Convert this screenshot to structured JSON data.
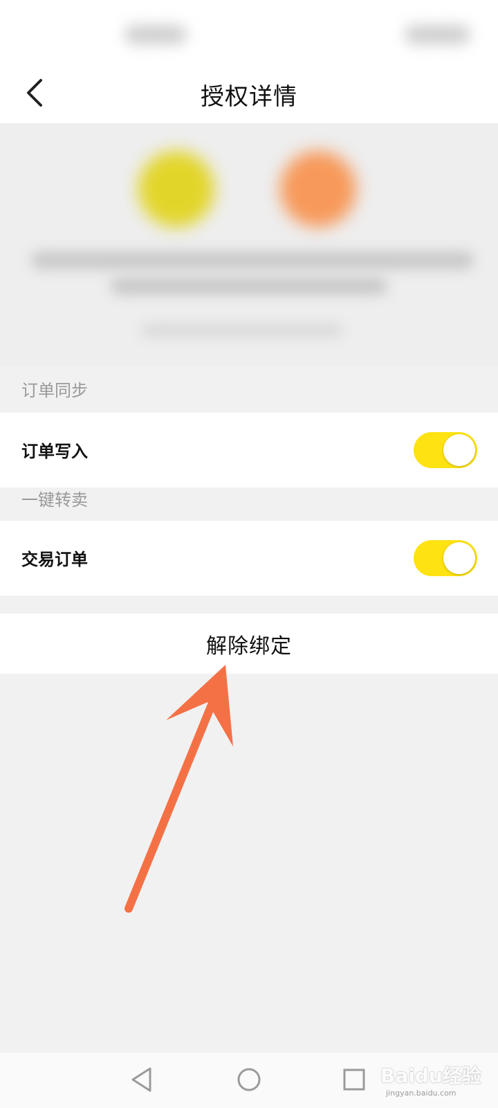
{
  "header": {
    "title": "授权详情"
  },
  "sections": [
    {
      "title": "订单同步",
      "rows": [
        {
          "label": "订单写入",
          "toggle_on": true
        }
      ]
    },
    {
      "title": "一键转卖",
      "rows": [
        {
          "label": "交易订单",
          "toggle_on": true
        }
      ]
    }
  ],
  "actions": {
    "unbind_label": "解除绑定"
  },
  "colors": {
    "toggle_on": "#ffe211",
    "annotation_arrow": "#f47146"
  },
  "watermark": {
    "brand": "Baidu经验",
    "url": "jingyan.baidu.com"
  },
  "system_nav": {
    "icons": [
      "back-triangle-icon",
      "home-circle-icon",
      "recents-square-icon"
    ]
  }
}
